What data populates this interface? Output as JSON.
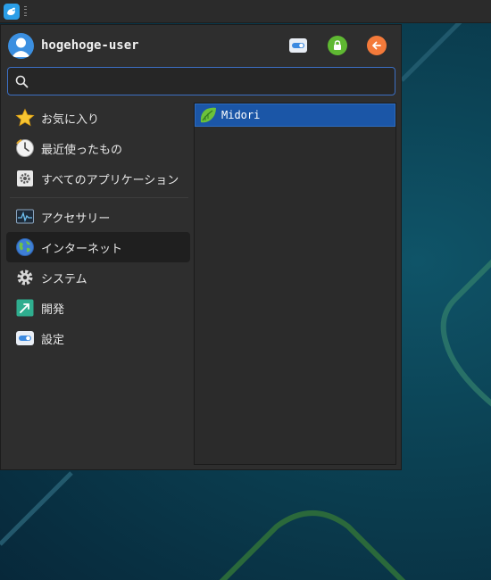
{
  "user": {
    "name": "hogehoge-user"
  },
  "search": {
    "value": "",
    "placeholder": ""
  },
  "categories": [
    {
      "label": "お気に入り",
      "icon": "star-icon"
    },
    {
      "label": "最近使ったもの",
      "icon": "recent-clock-icon"
    },
    {
      "label": "すべてのアプリケーション",
      "icon": "all-apps-gear-icon"
    },
    {
      "label": "アクセサリー",
      "icon": "accessories-monitor-icon"
    },
    {
      "label": "インターネット",
      "icon": "globe-icon",
      "selected": true
    },
    {
      "label": "システム",
      "icon": "gear-icon"
    },
    {
      "label": "開発",
      "icon": "development-icon"
    },
    {
      "label": "設定",
      "icon": "settings-toggle-icon"
    }
  ],
  "apps": [
    {
      "label": "Midori",
      "icon": "midori-leaf-icon",
      "selected": true
    }
  ],
  "colors": {
    "selection": "#1b56a7",
    "search_border": "#3c6fc4",
    "lock_button": "#5fb832",
    "logout_button": "#f47a3a",
    "avatar": "#3b8fe0"
  }
}
